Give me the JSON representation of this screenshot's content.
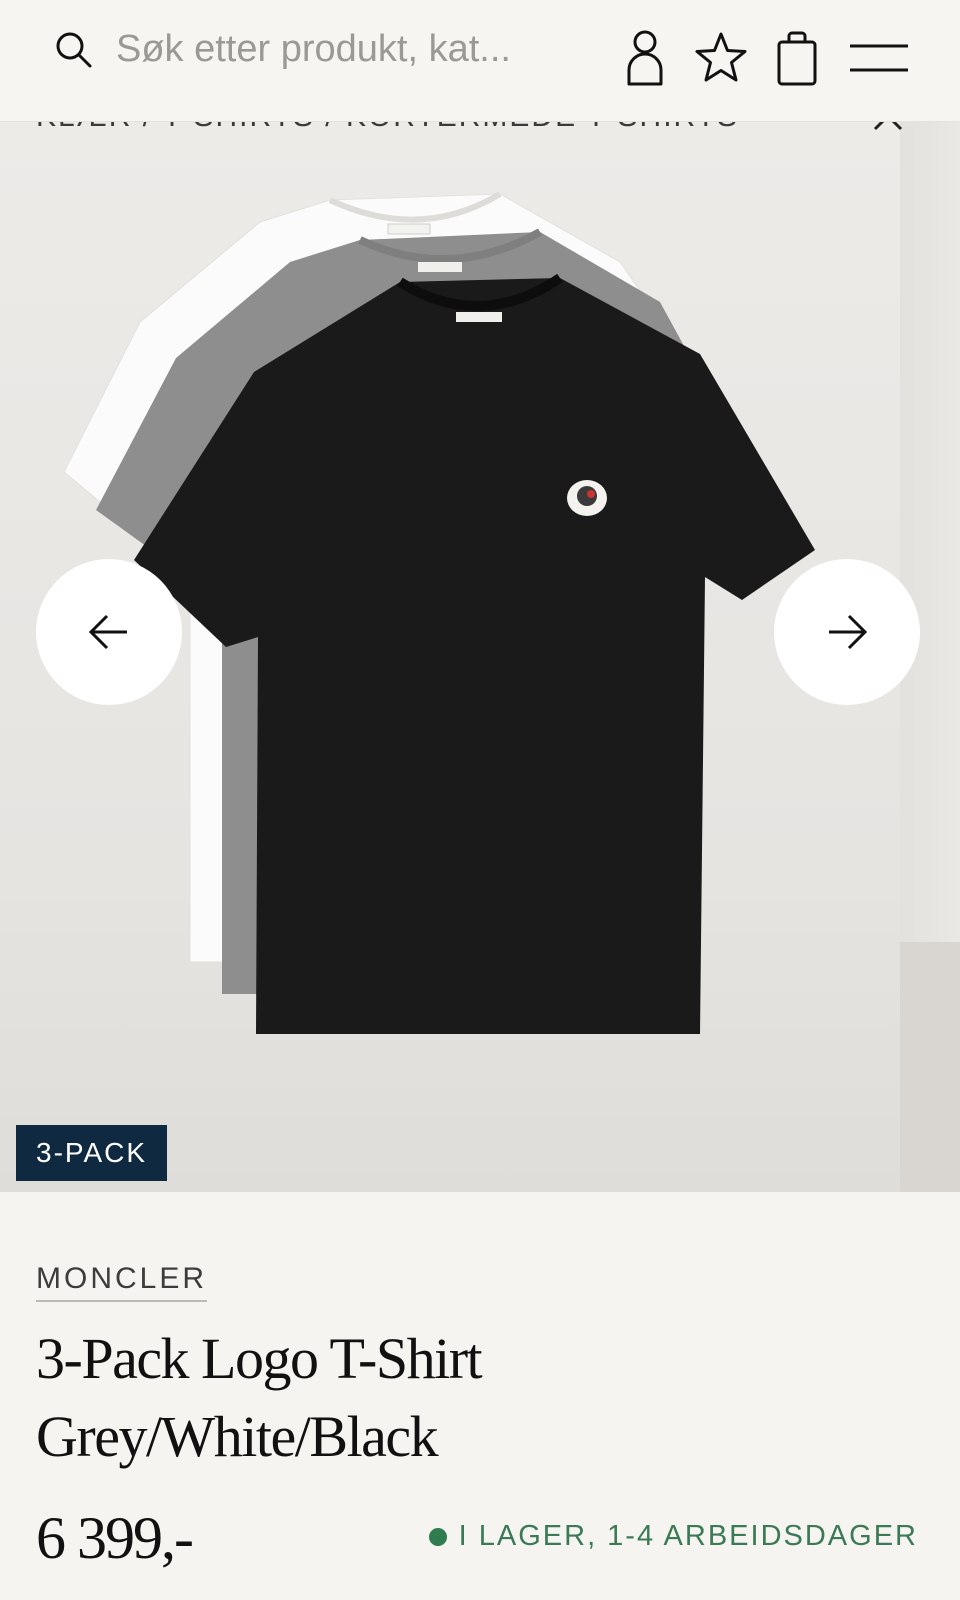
{
  "header": {
    "search_placeholder": "Søk etter produkt, kat...",
    "icons": [
      "search-icon",
      "account-icon",
      "wishlist-star-icon",
      "shopping-bag-icon",
      "hamburger-menu-icon"
    ]
  },
  "breadcrumb": {
    "text": "KLÆR / T-SHIRTS / KORTERMEDE T-SHIRTS"
  },
  "gallery": {
    "badge": "3-PACK",
    "prev_icon": "arrow-left-icon",
    "next_icon": "arrow-right-icon"
  },
  "product": {
    "brand": "MONCLER",
    "title_line1": "3-Pack Logo T-Shirt",
    "title_line2": "Grey/White/Black",
    "price": "6 399,-",
    "stock_status": "I LAGER, 1-4 ARBEIDSDAGER"
  },
  "colors": {
    "badge_bg": "#0f2a40",
    "stock_green": "#3b7a55",
    "header_bg": "#f6f5f2"
  }
}
